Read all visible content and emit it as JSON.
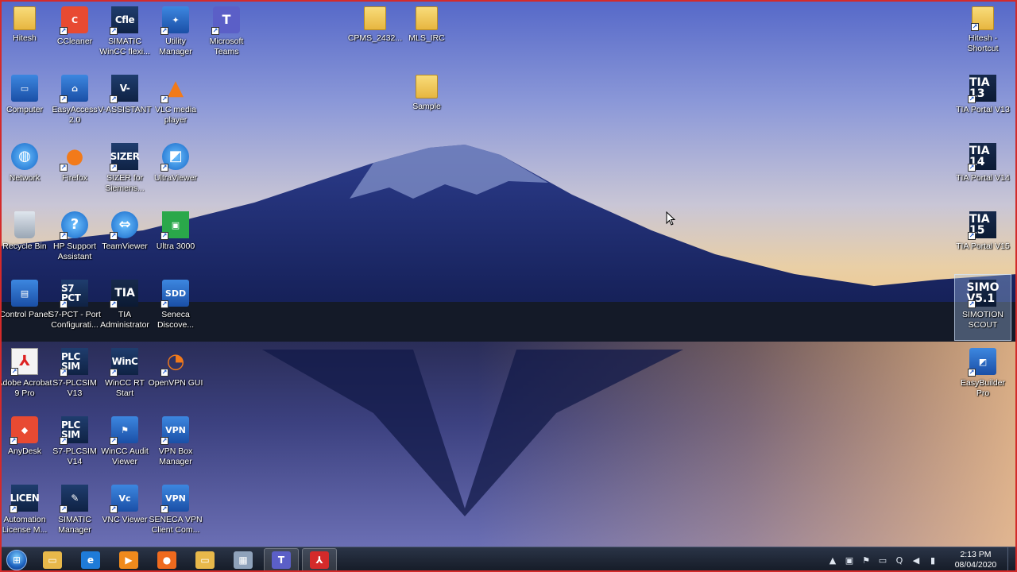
{
  "desktop": {
    "left_columns": [
      [
        {
          "label": "Hitesh",
          "icon": "user-folder-icon",
          "glyph": "",
          "style": "g-folder"
        },
        {
          "label": "Computer",
          "icon": "computer-icon",
          "glyph": "▭",
          "style": "g-blue"
        },
        {
          "label": "Network",
          "icon": "network-globe-icon",
          "glyph": "◍",
          "style": "g-round"
        },
        {
          "label": "Recycle Bin",
          "icon": "recycle-bin-icon",
          "glyph": "",
          "style": "g-bin"
        },
        {
          "label": "Control Panel",
          "icon": "control-panel-icon",
          "glyph": "▤",
          "style": "g-blue"
        },
        {
          "label": "Adobe Acrobat 9 Pro",
          "icon": "adobe-acrobat-icon",
          "glyph": "⅄",
          "style": "g-white"
        },
        {
          "label": "AnyDesk",
          "icon": "anydesk-icon",
          "glyph": "◆",
          "style": "g-red"
        },
        {
          "label": "Automation License M...",
          "icon": "automation-license-manager-icon",
          "glyph": "LICEN",
          "style": "g-dark"
        }
      ],
      [
        {
          "label": "CCleaner",
          "icon": "ccleaner-icon",
          "glyph": "C",
          "style": "g-red"
        },
        {
          "label": "EasyAccess 2.0",
          "icon": "easyaccess-icon",
          "glyph": "⌂",
          "style": "g-blue"
        },
        {
          "label": "Firefox",
          "icon": "firefox-icon",
          "glyph": "●",
          "style": "g-orange"
        },
        {
          "label": "HP Support Assistant",
          "icon": "hp-support-icon",
          "glyph": "?",
          "style": "g-round"
        },
        {
          "label": "S7-PCT - Port Configurati...",
          "icon": "s7-pct-icon",
          "glyph": "S7 PCT",
          "style": "g-dark"
        },
        {
          "label": "S7-PLCSIM V13",
          "icon": "plcsim-v13-icon",
          "glyph": "PLC SIM",
          "style": "g-dark"
        },
        {
          "label": "S7-PLCSIM V14",
          "icon": "plcsim-v14-icon",
          "glyph": "PLC SIM",
          "style": "g-dark"
        },
        {
          "label": "SIMATIC Manager",
          "icon": "simatic-manager-icon",
          "glyph": "✎",
          "style": "g-dark"
        }
      ],
      [
        {
          "label": "SIMATIC WinCC flexi...",
          "icon": "wincc-flexible-icon",
          "glyph": "Cfle",
          "style": "g-dark"
        },
        {
          "label": "V-ASSISTANT",
          "icon": "v-assistant-icon",
          "glyph": "V-",
          "style": "g-dark"
        },
        {
          "label": "SIZER for Siemens...",
          "icon": "sizer-icon",
          "glyph": "SIZER",
          "style": "g-dark"
        },
        {
          "label": "TeamViewer",
          "icon": "teamviewer-icon",
          "glyph": "⇔",
          "style": "g-round"
        },
        {
          "label": "TIA Administrator",
          "icon": "tia-administrator-icon",
          "glyph": "TIA",
          "style": "g-tia"
        },
        {
          "label": "WinCC RT Start",
          "icon": "wincc-rt-icon",
          "glyph": "WinC",
          "style": "g-dark"
        },
        {
          "label": "WinCC Audit Viewer",
          "icon": "wincc-audit-icon",
          "glyph": "⚑",
          "style": "g-blue"
        },
        {
          "label": "VNC Viewer",
          "icon": "vnc-viewer-icon",
          "glyph": "Vc",
          "style": "g-blue"
        }
      ],
      [
        {
          "label": "Utility Manager",
          "icon": "utility-manager-icon",
          "glyph": "✦",
          "style": "g-blue"
        },
        {
          "label": "VLC media player",
          "icon": "vlc-icon",
          "glyph": "▲",
          "style": "g-orange"
        },
        {
          "label": "UltraViewer",
          "icon": "ultraviewer-icon",
          "glyph": "◩",
          "style": "g-round"
        },
        {
          "label": "Ultra 3000",
          "icon": "ultra-3000-icon",
          "glyph": "▣",
          "style": "g-green"
        },
        {
          "label": "Seneca Discove...",
          "icon": "seneca-discovery-icon",
          "glyph": "SDD",
          "style": "g-blue"
        },
        {
          "label": "OpenVPN GUI",
          "icon": "openvpn-icon",
          "glyph": "◔",
          "style": "g-orange"
        },
        {
          "label": "VPN Box Manager",
          "icon": "vpn-box-manager-icon",
          "glyph": "VPN",
          "style": "g-blue"
        },
        {
          "label": "SENECA VPN Client Com...",
          "icon": "seneca-vpn-icon",
          "glyph": "VPN",
          "style": "g-blue"
        }
      ],
      [
        {
          "label": "Microsoft Teams",
          "icon": "microsoft-teams-icon",
          "glyph": "T",
          "style": "g-teams"
        }
      ]
    ],
    "middle_icons": [
      {
        "label": "CPMS_2432...",
        "icon": "folder-icon",
        "glyph": "",
        "style": "g-folder"
      },
      {
        "label": "MLS_IRC",
        "icon": "folder-icon",
        "glyph": "",
        "style": "g-folder"
      },
      {
        "label": "Sample",
        "icon": "folder-icon",
        "glyph": "",
        "style": "g-folder"
      }
    ],
    "right_icons": [
      {
        "label": "Hitesh - Shortcut",
        "icon": "folder-shortcut-icon",
        "glyph": "",
        "style": "g-folder",
        "selected": false
      },
      {
        "label": "TIA Portal V13",
        "icon": "tia-portal-v13-icon",
        "glyph": "TIA 13",
        "style": "g-tia",
        "selected": false
      },
      {
        "label": "TIA Portal V14",
        "icon": "tia-portal-v14-icon",
        "glyph": "TIA 14",
        "style": "g-tia",
        "selected": false
      },
      {
        "label": "TIA Portal V15",
        "icon": "tia-portal-v15-icon",
        "glyph": "TIA 15",
        "style": "g-tia",
        "selected": false
      },
      {
        "label": "SIMOTION SCOUT",
        "icon": "simotion-scout-icon",
        "glyph": "SIMO V5.1",
        "style": "g-tia",
        "selected": true
      },
      {
        "label": "EasyBuilder Pro",
        "icon": "easybuilder-pro-icon",
        "glyph": "◩",
        "style": "g-blue",
        "selected": false
      }
    ]
  },
  "taskbar": {
    "start_icon": "windows-start-orb-icon",
    "pinned": [
      {
        "name": "file-explorer-icon",
        "glyph": "▭",
        "color": "#e8b84a",
        "open": false
      },
      {
        "name": "internet-explorer-icon",
        "glyph": "e",
        "color": "#1f7bd8",
        "open": false
      },
      {
        "name": "media-player-icon",
        "glyph": "▶",
        "color": "#f08a1c",
        "open": false
      },
      {
        "name": "firefox-taskbar-icon",
        "glyph": "●",
        "color": "#ef6a1e",
        "open": false
      },
      {
        "name": "folder-taskbar-icon",
        "glyph": "▭",
        "color": "#e8b84a",
        "open": false
      },
      {
        "name": "calculator-icon",
        "glyph": "▦",
        "color": "#8fa2bb",
        "open": false
      },
      {
        "name": "teams-taskbar-icon",
        "glyph": "T",
        "color": "#5b5fc7",
        "open": true
      },
      {
        "name": "acrobat-taskbar-icon",
        "glyph": "⅄",
        "color": "#d42a2a",
        "open": true
      }
    ],
    "tray": [
      {
        "name": "show-hidden-icons-icon",
        "glyph": "▲"
      },
      {
        "name": "network-monitor-icon",
        "glyph": "▣"
      },
      {
        "name": "action-center-icon",
        "glyph": "⚑"
      },
      {
        "name": "display-icon",
        "glyph": "▭"
      },
      {
        "name": "qbittorrent-icon",
        "glyph": "Q"
      },
      {
        "name": "volume-icon",
        "glyph": "◀"
      },
      {
        "name": "signal-icon",
        "glyph": "▮"
      }
    ],
    "clock": {
      "time": "2:13 PM",
      "date": "08/04/2020"
    }
  }
}
